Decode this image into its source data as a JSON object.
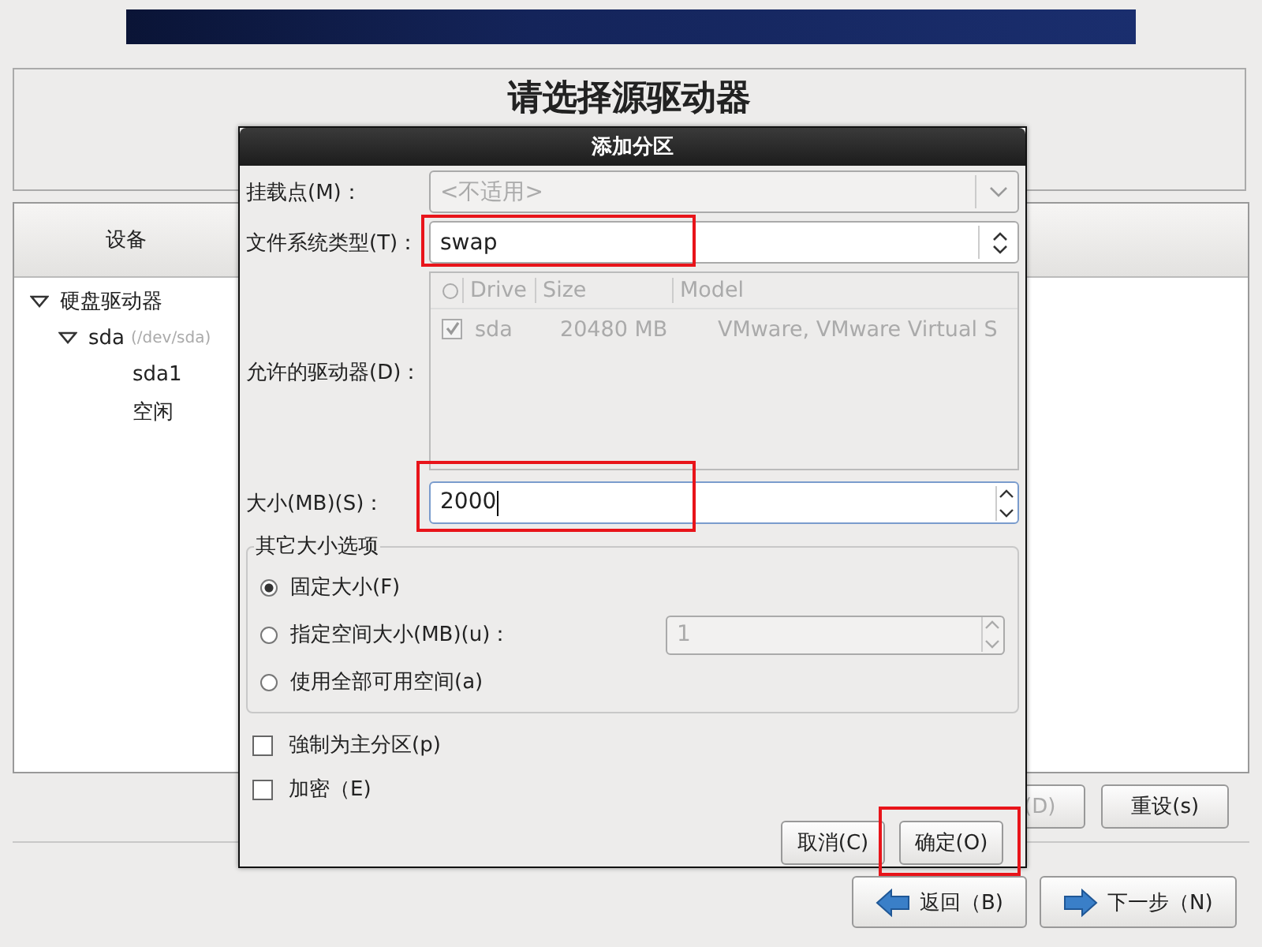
{
  "page_title": "请选择源驱动器",
  "device_table": {
    "columns": [
      "设备"
    ],
    "tree": [
      {
        "label": "硬盘驱动器",
        "expanded": true,
        "children": [
          {
            "label": "sda",
            "detail": "(/dev/sda)",
            "expanded": true,
            "children": [
              {
                "label": "sda1"
              },
              {
                "label": "空闲"
              }
            ]
          }
        ]
      }
    ]
  },
  "panel_buttons": [
    {
      "label": "(D)",
      "disabled": true
    },
    {
      "label": "重设(s)",
      "disabled": false
    }
  ],
  "nav_buttons": [
    {
      "label": "返回（B)",
      "kind": "back"
    },
    {
      "label": "下一步（N)",
      "kind": "next"
    }
  ],
  "dialog": {
    "title": "添加分区",
    "mount_point": {
      "label": "挂载点(M)：",
      "value": "<不适用>",
      "disabled": true
    },
    "fs_type": {
      "label": "文件系统类型(T)：",
      "value": "swap",
      "highlighted": true
    },
    "drives": {
      "label": "允许的驱动器(D)：",
      "columns": [
        "Drive",
        "Size",
        "Model"
      ],
      "rows": [
        {
          "checked": true,
          "drive": "sda",
          "size": "20480 MB",
          "model": "VMware, VMware Virtual S"
        }
      ]
    },
    "size": {
      "label": "大小(MB)(S)：",
      "value": "2000",
      "highlighted": true
    },
    "size_options": {
      "title": "其它大小选项",
      "options": [
        {
          "label": "固定大小(F)",
          "selected": true
        },
        {
          "label": "指定空间大小(MB)(u)：",
          "selected": false,
          "value": "1"
        },
        {
          "label": "使用全部可用空间(a)",
          "selected": false
        }
      ]
    },
    "checkboxes": [
      {
        "label": "強制为主分区(p)",
        "checked": false
      },
      {
        "label": "加密（E)",
        "checked": false
      }
    ],
    "buttons": [
      {
        "label": "取消(C)",
        "highlighted": false
      },
      {
        "label": "确定(O)",
        "highlighted": true
      }
    ]
  }
}
